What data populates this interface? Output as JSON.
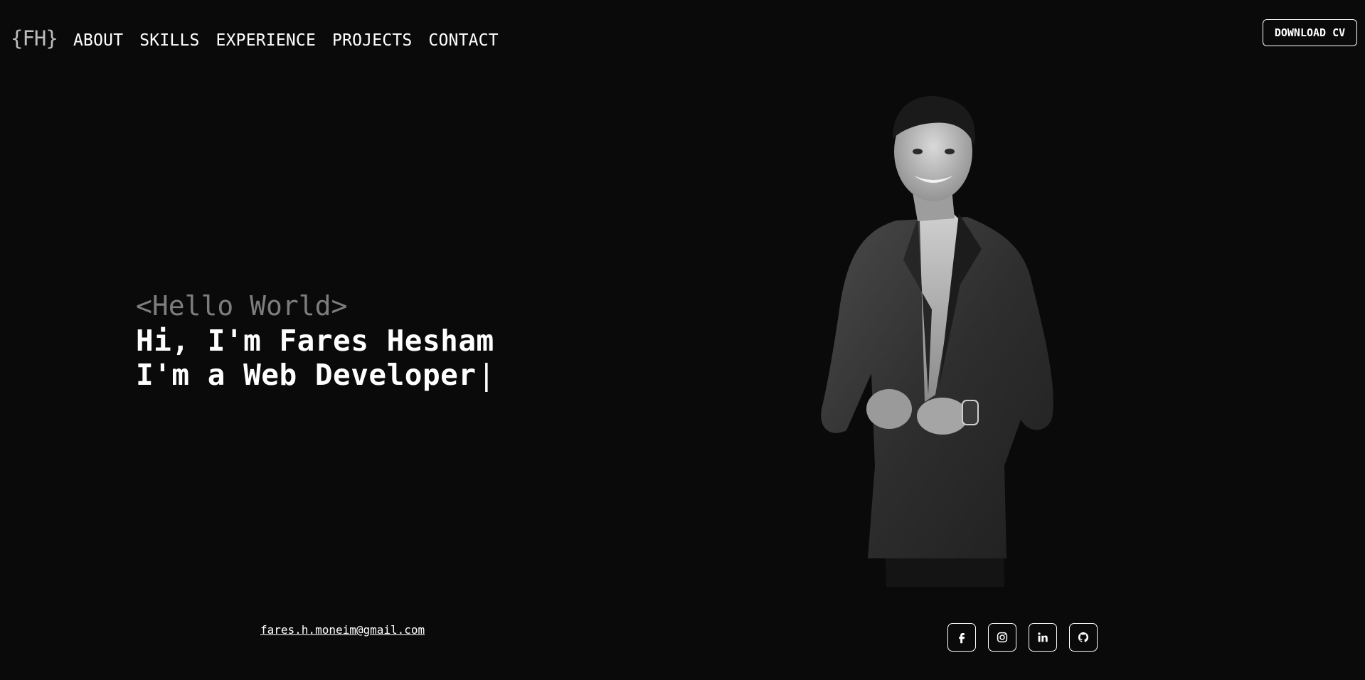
{
  "brand": {
    "logo_text": "{FH}"
  },
  "nav": {
    "items": [
      {
        "label": "ABOUT"
      },
      {
        "label": "SKILLS"
      },
      {
        "label": "EXPERIENCE"
      },
      {
        "label": "PROJECTS"
      },
      {
        "label": "CONTACT"
      }
    ]
  },
  "header": {
    "cv_button_label": "DOWNLOAD CV"
  },
  "hero": {
    "greeting": "<Hello World>",
    "name_line": "Hi, I'm Fares Hesham",
    "role_line": "I'm a Web Developer",
    "cursor": "|"
  },
  "contact": {
    "email": "fares.h.moneim@gmail.com"
  },
  "socials": [
    {
      "icon": "facebook-icon"
    },
    {
      "icon": "instagram-icon"
    },
    {
      "icon": "linkedin-icon"
    },
    {
      "icon": "github-icon"
    }
  ],
  "colors": {
    "background": "#0a0a0b",
    "text": "#ffffff",
    "muted": "#7d7d7d"
  }
}
